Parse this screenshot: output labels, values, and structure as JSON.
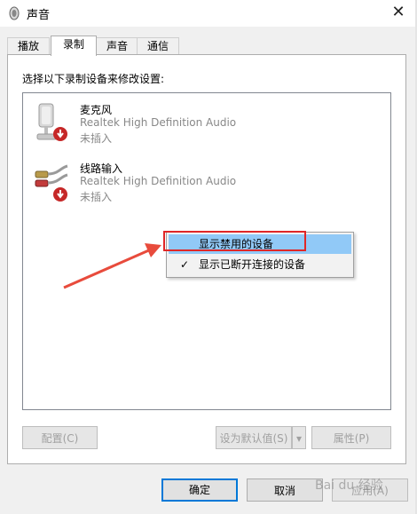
{
  "window": {
    "title": "声音",
    "close_symbol": "✕"
  },
  "tabs": [
    {
      "label": "播放",
      "active": false
    },
    {
      "label": "录制",
      "active": true
    },
    {
      "label": "声音",
      "active": false
    },
    {
      "label": "通信",
      "active": false
    }
  ],
  "instruction": "选择以下录制设备来修改设置:",
  "devices": [
    {
      "name": "麦克风",
      "description": "Realtek High Definition Audio",
      "status": "未插入",
      "icon": "microphone-icon"
    },
    {
      "name": "线路输入",
      "description": "Realtek High Definition Audio",
      "status": "未插入",
      "icon": "line-in-icon"
    }
  ],
  "context_menu": {
    "items": [
      {
        "label": "显示禁用的设备",
        "checked": false,
        "highlighted": true
      },
      {
        "label": "显示已断开连接的设备",
        "checked": true,
        "highlighted": false
      }
    ],
    "check_symbol": "✓"
  },
  "buttons": {
    "configure": "配置(C)",
    "set_default": "设为默认值(S)",
    "properties": "属性(P)",
    "ok": "确定",
    "cancel": "取消",
    "apply": "应用(A)"
  },
  "watermark": "Bai du 经验",
  "colors": {
    "highlight_border": "#e02727",
    "menu_highlight": "#91c9f7",
    "default_button_border": "#0078d7",
    "arrow": "#e84b3c"
  }
}
